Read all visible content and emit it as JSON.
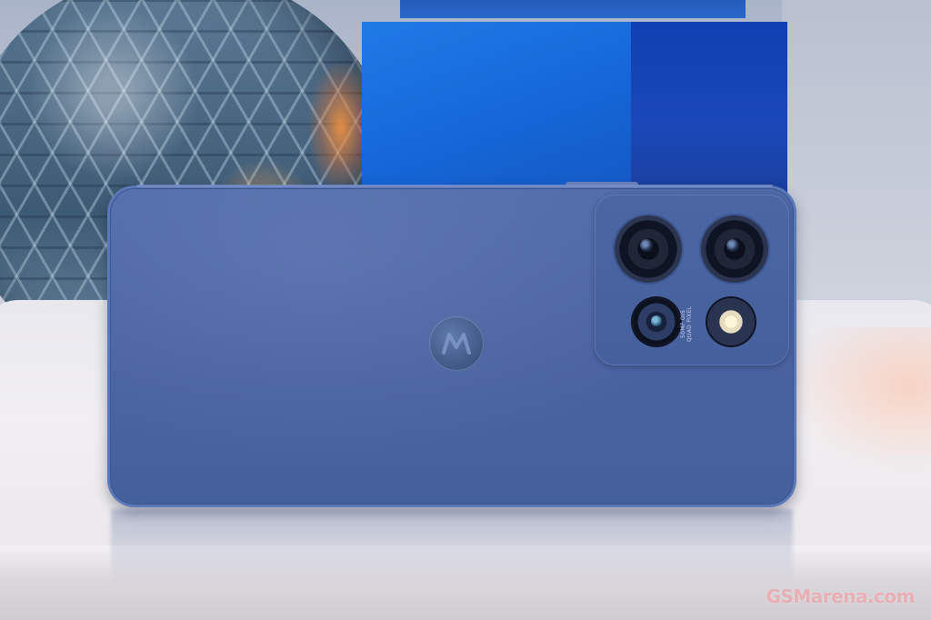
{
  "photo": {
    "subject": "smartphone-back",
    "colors": {
      "phone_body": "#4a63a0",
      "camera_island": "#46609c",
      "box_front": "#1f7ae6",
      "box_side": "#0f3fb2",
      "table": "#ecebef",
      "vase": "#4c6a86"
    }
  },
  "camera": {
    "label_line1": "50MP OIS",
    "label_line2": "QUAD PIXEL"
  },
  "watermark": {
    "text": "GSMarena.com"
  }
}
